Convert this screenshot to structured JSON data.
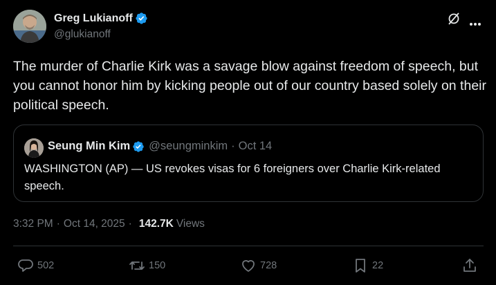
{
  "author": {
    "name": "Greg Lukianoff",
    "handle": "@glukianoff",
    "verified_color": "#1d9bf0"
  },
  "header_icons": [
    "grok-icon",
    "more-icon"
  ],
  "tweet": {
    "text": "The murder of Charlie Kirk was a savage blow against freedom of speech, but you cannot honor him by kicking people out of our country based solely on their political speech."
  },
  "quote": {
    "name": "Seung Min Kim",
    "handle": "@seungminkim",
    "separator": "·",
    "date": "Oct 14",
    "text": "WASHINGTON (AP) — US revokes visas for 6 foreigners over Charlie Kirk-related speech."
  },
  "meta": {
    "time": "3:32 PM",
    "separator": "·",
    "date": "Oct 14, 2025",
    "views_count": "142.7K",
    "views_label": "Views"
  },
  "actions": {
    "replies": "502",
    "retweets": "150",
    "likes": "728",
    "bookmarks": "22"
  }
}
